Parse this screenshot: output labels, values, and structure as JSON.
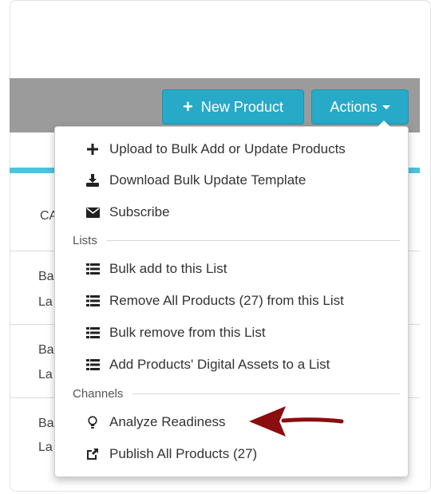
{
  "toolbar": {
    "new_product_label": "New Product",
    "actions_label": "Actions"
  },
  "background": {
    "column_header_fragment": "CA",
    "rows": [
      {
        "line1": "Ba",
        "line2": "La"
      },
      {
        "line1": "Ba",
        "line2": "La"
      },
      {
        "line1": "Ba",
        "line2": "La"
      }
    ]
  },
  "menu": {
    "items": [
      {
        "label": "Upload to Bulk Add or Update Products",
        "icon": "plus-icon"
      },
      {
        "label": "Download Bulk Update Template",
        "icon": "download-icon"
      },
      {
        "label": "Subscribe",
        "icon": "envelope-icon"
      }
    ],
    "lists_header": "Lists",
    "list_items": [
      {
        "label": "Bulk add to this List",
        "icon": "list-icon"
      },
      {
        "label": "Remove All Products (27) from this List",
        "icon": "list-icon"
      },
      {
        "label": "Bulk remove from this List",
        "icon": "list-icon"
      },
      {
        "label": "Add Products' Digital Assets to a List",
        "icon": "list-icon"
      }
    ],
    "channels_header": "Channels",
    "channel_items": [
      {
        "label": "Analyze Readiness",
        "icon": "lightbulb-icon"
      },
      {
        "label": "Publish All Products (27)",
        "icon": "share-icon"
      }
    ]
  },
  "colors": {
    "primary_button": "#27a9c8",
    "toolbar_bg": "#9b9b9b",
    "accent_bar": "#4dc3e0",
    "annotation_arrow": "#8b0d10"
  }
}
